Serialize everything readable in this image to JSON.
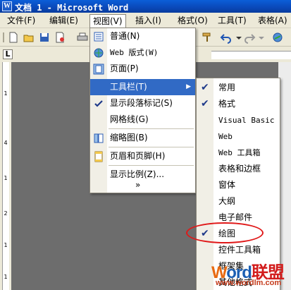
{
  "window": {
    "title": "文档 1 - Microsoft Word",
    "app_icon": "W"
  },
  "menubar": {
    "items": [
      "文件(F)",
      "编辑(E)",
      "视图(V)",
      "插入(I)",
      "格式(O)",
      "工具(T)",
      "表格(A)"
    ]
  },
  "view_menu": {
    "items": [
      {
        "label": "普通(N)",
        "icon": "normal-view-icon"
      },
      {
        "label": "Web 版式(W)",
        "icon": "web-layout-icon"
      },
      {
        "label": "页面(P)",
        "icon": "page-layout-icon"
      },
      {
        "label": "工具栏(T)",
        "highlighted": true,
        "submenu": true
      },
      {
        "label": "显示段落标记(S)",
        "checked": true
      },
      {
        "label": "网格线(G)"
      },
      {
        "label": "缩略图(B)",
        "icon": "thumbnails-icon"
      },
      {
        "label": "页眉和页脚(H)",
        "icon": "header-footer-icon"
      },
      {
        "label": "显示比例(Z)..."
      }
    ],
    "expand_glyph": "»"
  },
  "toolbars_submenu": {
    "items": [
      {
        "label": "常用",
        "checked": true
      },
      {
        "label": "格式",
        "checked": true
      },
      {
        "label": "Visual Basic",
        "checked": false
      },
      {
        "label": "Web",
        "checked": false
      },
      {
        "label": "Web 工具箱",
        "checked": false
      },
      {
        "label": "表格和边框",
        "checked": false
      },
      {
        "label": "窗体",
        "checked": false
      },
      {
        "label": "大纲",
        "checked": false
      },
      {
        "label": "电子邮件",
        "checked": false
      },
      {
        "label": "绘图",
        "checked": true
      },
      {
        "label": "控件工具箱",
        "checked": false
      },
      {
        "label": "框架集",
        "checked": false
      },
      {
        "label": "其他格式",
        "checked": false
      }
    ]
  },
  "ruler": {
    "tab_selector": "L",
    "vertical_ticks": [
      "1",
      "4",
      "1",
      "2",
      "1",
      "1"
    ]
  },
  "watermark": {
    "brand_w": "W",
    "brand_ord": "ord",
    "brand_cn": "联盟",
    "url": "www.wordlm.com"
  },
  "colors": {
    "title_bar": "#0a48b8",
    "highlight": "#316ac5",
    "menu_bg": "#ece9d8",
    "annotation": "#e01818"
  }
}
